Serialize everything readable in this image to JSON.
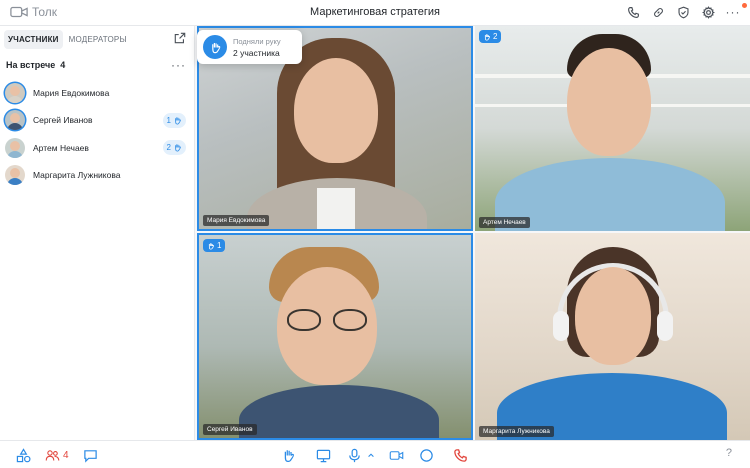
{
  "header": {
    "app_name": "Толк",
    "title": "Маркетинговая стратегия",
    "icons": [
      "phone-icon",
      "link-icon",
      "shield-icon",
      "gear-icon",
      "more-icon"
    ]
  },
  "sidebar": {
    "tabs": [
      {
        "label": "УЧАСТНИКИ",
        "active": true
      },
      {
        "label": "МОДЕРАТОРЫ",
        "active": false
      }
    ],
    "meeting_label": "На встрече",
    "meeting_count": "4",
    "participants": [
      {
        "name": "Мария Евдокимова",
        "hand": ""
      },
      {
        "name": "Сергей Иванов",
        "hand": "1"
      },
      {
        "name": "Артем Нечаев",
        "hand": "2"
      },
      {
        "name": "Маргарита Лужникова",
        "hand": ""
      }
    ]
  },
  "popup": {
    "title": "Подняли руку",
    "subtitle": "2 участника"
  },
  "tiles": [
    {
      "name": "Мария Евдокимова",
      "hand": ""
    },
    {
      "name": "Артем Нечаев",
      "hand": "2"
    },
    {
      "name": "Сергей Иванов",
      "hand": "1"
    },
    {
      "name": "Маргарита Лужникова",
      "hand": ""
    }
  ],
  "bottom": {
    "participants_count": "4",
    "help": "?"
  },
  "colors": {
    "accent": "#2b8be6",
    "danger": "#e2453c"
  }
}
